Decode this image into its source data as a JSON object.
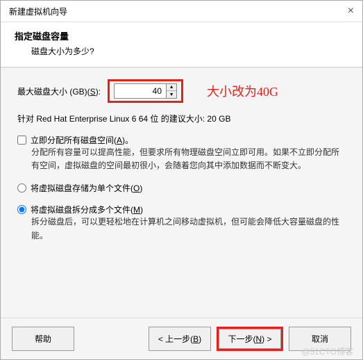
{
  "window": {
    "title": "新建虚拟机向导",
    "close": "×"
  },
  "header": {
    "heading": "指定磁盘容量",
    "sub": "磁盘大小为多少?"
  },
  "disk": {
    "label_prefix": "最大磁盘大小 (GB)(",
    "label_key": "S",
    "label_suffix": "):",
    "value": "40",
    "annotation": "大小改为40G",
    "recommendation": "针对 Red Hat Enterprise Linux 6 64 位 的建议大小: 20 GB"
  },
  "allocate": {
    "label_prefix": "立即分配所有磁盘空间(",
    "label_key": "A",
    "label_suffix": ")。",
    "desc": "分配所有容量可以提高性能，但要求所有物理磁盘空间立即可用。如果不立即分配所有空间，虚拟磁盘的空间最初很小，会随着您向其中添加数据而不断变大。"
  },
  "split": {
    "single_prefix": "将虚拟磁盘存储为单个文件(",
    "single_key": "O",
    "single_suffix": ")",
    "multi_prefix": "将虚拟磁盘拆分成多个文件(",
    "multi_key": "M",
    "multi_suffix": ")",
    "multi_desc": "拆分磁盘后，可以更轻松地在计算机之间移动虚拟机，但可能会降低大容量磁盘的性能。"
  },
  "footer": {
    "help": "帮助",
    "back_prefix": "< 上一步(",
    "back_key": "B",
    "back_suffix": ")",
    "next_prefix": "下一步(",
    "next_key": "N",
    "next_suffix": ") >",
    "cancel": "取消"
  },
  "watermark": "@51CTO博客"
}
